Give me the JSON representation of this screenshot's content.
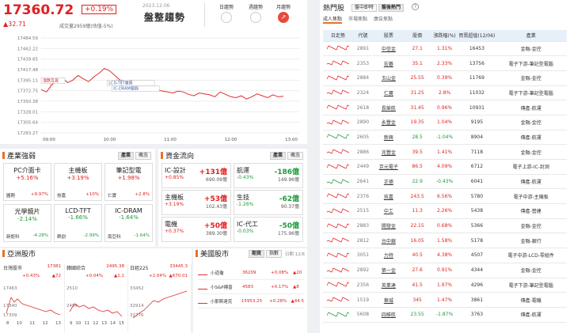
{
  "index": {
    "value": "17360.72",
    "change_pct": "+0.19%",
    "change": "▲32.71",
    "volume": "成交量2959億(估值-5%)",
    "date": "2023.12.06",
    "trend_title": "盤整趨勢"
  },
  "trend_buttons": [
    {
      "label": "日趨勢"
    },
    {
      "label": "週趨勢"
    },
    {
      "label": "月趨勢"
    }
  ],
  "chart_data": {
    "type": "line",
    "yticks": [
      "17484.59",
      "17462.22",
      "17439.85",
      "17417.48",
      "17395.11",
      "17372.75",
      "17350.38",
      "17328.01",
      "17305.64",
      "17283.27"
    ],
    "xticks": [
      "09:00",
      "10:00",
      "11:00",
      "12:00",
      "13:00"
    ],
    "ylim": [
      17283.27,
      17484.59
    ],
    "annotations": [
      "漲跌互見",
      "LCD-TFT重挫",
      "IC-DRAM偏弱"
    ],
    "values": [
      17375,
      17370,
      17385,
      17395,
      17400,
      17390,
      17395,
      17405,
      17398,
      17392,
      17402,
      17410,
      17420,
      17415,
      17405,
      17395,
      17390,
      17395,
      17392,
      17385,
      17380,
      17378,
      17375,
      17372,
      17370,
      17368,
      17372,
      17370,
      17365,
      17362,
      17368,
      17366,
      17364,
      17360,
      17370,
      17365,
      17360,
      17358,
      17362,
      17355,
      17360,
      17366,
      17362,
      17358,
      17364,
      17360,
      17360.72
    ]
  },
  "industry": {
    "title": "產業強弱",
    "tabs": [
      "產業",
      "概念"
    ],
    "cards": [
      {
        "name": "PC介面卡",
        "pct": "+5.16%",
        "leader": "圓剛",
        "lpct": "+9.97%",
        "color": "red"
      },
      {
        "name": "主機板",
        "pct": "+3.19%",
        "leader": "技嘉",
        "lpct": "+10%",
        "color": "red"
      },
      {
        "name": "筆記型電",
        "pct": "+1.98%",
        "leader": "仁寶",
        "lpct": "+2.8%",
        "color": "red"
      },
      {
        "name": "光學鏡片",
        "pct": "-2.14%",
        "leader": "新鉅科",
        "lpct": "-4.28%",
        "color": "green"
      },
      {
        "name": "LCD-TFT",
        "pct": "-1.66%",
        "leader": "群創",
        "lpct": "-2.99%",
        "color": "green"
      },
      {
        "name": "IC-DRAM",
        "pct": "-1.64%",
        "leader": "南亞科",
        "lpct": "-1.64%",
        "color": "green"
      }
    ]
  },
  "flow": {
    "title": "資金流向",
    "tabs": [
      "產業",
      "概念"
    ],
    "items": [
      {
        "name": "IC-設計",
        "pct": "+0.85%",
        "amt": "+131億",
        "sub": "690.09億",
        "color": "red"
      },
      {
        "name": "航運",
        "pct": "-0.43%",
        "amt": "-186億",
        "sub": "149.96億",
        "color": "green"
      },
      {
        "name": "主機板",
        "pct": "+3.19%",
        "amt": "+53億",
        "sub": "102.43億",
        "color": "red"
      },
      {
        "name": "生技",
        "pct": "-1.26%",
        "amt": "-62億",
        "sub": "90.37億",
        "color": "green"
      },
      {
        "name": "電機",
        "pct": "+0.37%",
        "amt": "+50億",
        "sub": "389.30億",
        "color": "red"
      },
      {
        "name": "IC-代工",
        "pct": "-0.03%",
        "amt": "-50億",
        "sub": "175.96億",
        "color": "green"
      }
    ]
  },
  "asia": {
    "title": "亞洲股市",
    "markets": [
      {
        "name": "台灣股市",
        "value": "17381",
        "pct": "+0.43%",
        "chg": "▲72",
        "lo1": "17463",
        "lo2": "17340",
        "lo3": "17309",
        "xt": [
          "8",
          "10",
          "11",
          "12",
          "13"
        ]
      },
      {
        "name": "韓國綜合",
        "value": "2495.38",
        "pct": "+0.04%",
        "chg": "▲1.1",
        "lo1": "2510",
        "lo2": "2494",
        "lo3": "",
        "xt": [
          "9",
          "10",
          "11",
          "12",
          "13",
          "14",
          "15"
        ]
      },
      {
        "name": "日經225",
        "value": "33445.3",
        "pct": "+2.04%",
        "chg": "▲670.01",
        "lo1": "33452",
        "lo2": "32914",
        "lo3": "32776",
        "xt": []
      }
    ]
  },
  "us": {
    "title": "美國股市",
    "tabs": [
      "期貨",
      "指數"
    ],
    "date": "日期 12/6",
    "rows": [
      {
        "name": "小道瓊",
        "value": "36209",
        "pct": "+0.08%",
        "chg": "▲20"
      },
      {
        "name": "小S&P標普",
        "value": "4583",
        "value2": "",
        "pct": "+0.17%",
        "chg": "▲8"
      },
      {
        "name": "小那斯達克",
        "value": "15953.25",
        "pct": "+0.28%",
        "chg": "▲44.5"
      }
    ]
  },
  "hot": {
    "title": "熱門股",
    "tabs": [
      "盤中即時",
      "盤後熱門"
    ],
    "subtabs": [
      "成人焦點",
      "市場焦點",
      "廣告焦點"
    ],
    "headers": [
      "日走勢",
      "代號",
      "股票",
      "股價",
      "漲跌幅(%)",
      "買賣超值(12/06)",
      "產業"
    ],
    "rows": [
      {
        "code": "2891",
        "name": "中信金",
        "price": "27.1",
        "pct": "1.31%",
        "amt": "16453",
        "ind": "金融-金控",
        "c": "red"
      },
      {
        "code": "2353",
        "name": "宏碁",
        "price": "35.1",
        "pct": "2.33%",
        "amt": "13756",
        "ind": "電子下游-筆記型電腦",
        "c": "red"
      },
      {
        "code": "2884",
        "name": "玉山金",
        "price": "25.55",
        "pct": "0.39%",
        "amt": "11769",
        "ind": "金融-金控",
        "c": "red"
      },
      {
        "code": "2324",
        "name": "仁寶",
        "price": "31.25",
        "pct": "2.8%",
        "amt": "11032",
        "ind": "電子下游-筆記型電腦",
        "c": "red"
      },
      {
        "code": "2618",
        "name": "長榮航",
        "price": "31.45",
        "pct": "0.96%",
        "amt": "10931",
        "ind": "傳產-航運",
        "c": "red"
      },
      {
        "code": "2890",
        "name": "永豐金",
        "price": "19.35",
        "pct": "1.04%",
        "amt": "9195",
        "ind": "金融-金控",
        "c": "red"
      },
      {
        "code": "2605",
        "name": "新興",
        "price": "28.5",
        "pct": "-1.04%",
        "amt": "8904",
        "ind": "傳產-航運",
        "c": "green"
      },
      {
        "code": "2886",
        "name": "兆豐金",
        "price": "39.5",
        "pct": "1.41%",
        "amt": "7118",
        "ind": "金融-金控",
        "c": "red"
      },
      {
        "code": "2449",
        "name": "京元電子",
        "price": "86.5",
        "pct": "4.09%",
        "amt": "6712",
        "ind": "電子上游-IC-封測",
        "c": "red"
      },
      {
        "code": "2641",
        "name": "正德",
        "price": "22.9",
        "pct": "-0.43%",
        "amt": "6041",
        "ind": "傳產-航運",
        "c": "green"
      },
      {
        "code": "2376",
        "name": "技嘉",
        "price": "243.5",
        "pct": "6.56%",
        "amt": "5780",
        "ind": "電子中游-主機板",
        "c": "red"
      },
      {
        "code": "2515",
        "name": "中工",
        "price": "11.3",
        "pct": "2.26%",
        "amt": "5438",
        "ind": "傳產-營建",
        "c": "red"
      },
      {
        "code": "2883",
        "name": "開發金",
        "price": "22.15",
        "pct": "0.68%",
        "amt": "5366",
        "ind": "金融-金控",
        "c": "red"
      },
      {
        "code": "2812",
        "name": "台中銀",
        "price": "16.05",
        "pct": "1.58%",
        "amt": "5178",
        "ind": "金融-銀行",
        "c": "red"
      },
      {
        "code": "3051",
        "name": "力特",
        "price": "40.5",
        "pct": "4.38%",
        "amt": "4507",
        "ind": "電子中游-LCD-零組件",
        "c": "red"
      },
      {
        "code": "2892",
        "name": "第一金",
        "price": "27.6",
        "pct": "0.91%",
        "amt": "4344",
        "ind": "金融-金控",
        "c": "red"
      },
      {
        "code": "2356",
        "name": "英業達",
        "price": "41.5",
        "pct": "1.97%",
        "amt": "4296",
        "ind": "電子下游-筆記型電腦",
        "c": "red"
      },
      {
        "code": "1519",
        "name": "華城",
        "price": "345",
        "pct": "1.47%",
        "amt": "3861",
        "ind": "傳產-電機",
        "c": "red"
      },
      {
        "code": "5608",
        "name": "四維航",
        "price": "23.55",
        "pct": "-1.87%",
        "amt": "3763",
        "ind": "傳產-航運",
        "c": "green"
      }
    ]
  }
}
